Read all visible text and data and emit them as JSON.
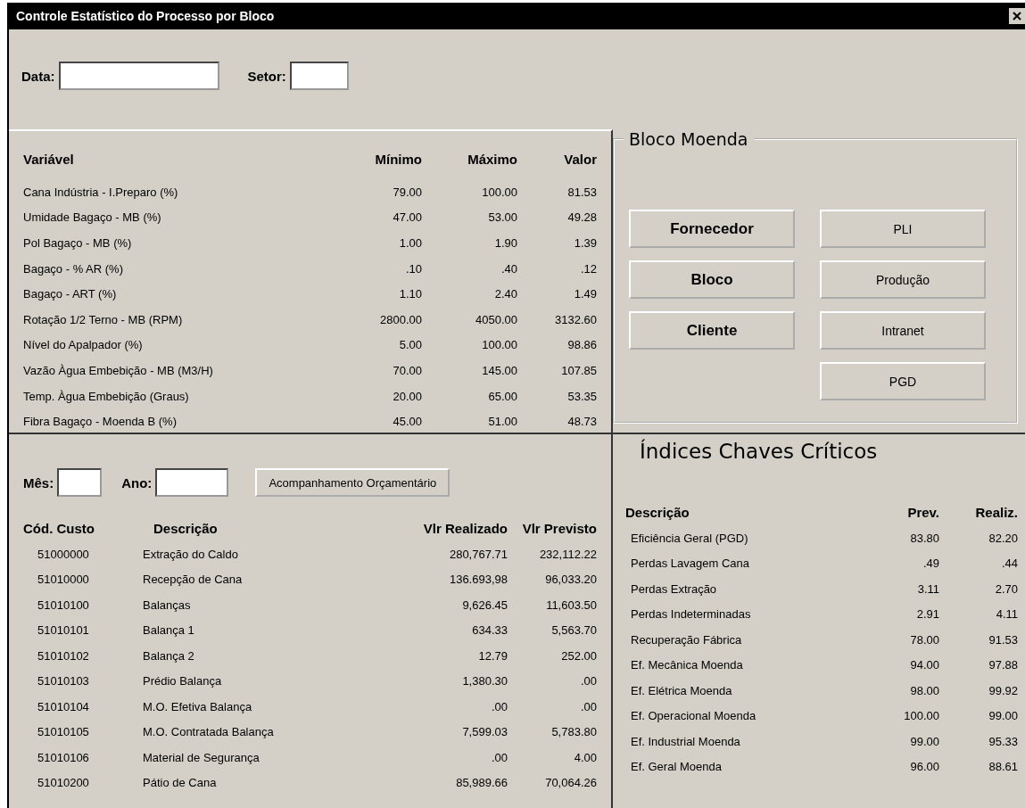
{
  "window": {
    "title": "Controle Estatístico do Processo por Bloco"
  },
  "filters": {
    "data_label": "Data:",
    "setor_label": "Setor:"
  },
  "variables": {
    "columns": [
      "Variável",
      "Mínimo",
      "Máximo",
      "Valor"
    ],
    "rows": [
      [
        "Cana Indústria - I.Preparo (%)",
        "79.00",
        "100.00",
        "81.53"
      ],
      [
        "Umidade Bagaço - MB (%)",
        "47.00",
        "53.00",
        "49.28"
      ],
      [
        "Pol Bagaço - MB (%)",
        "1.00",
        "1.90",
        "1.39"
      ],
      [
        "Bagaço - % AR (%)",
        ".10",
        ".40",
        ".12"
      ],
      [
        "Bagaço - ART (%)",
        "1.10",
        "2.40",
        "1.49"
      ],
      [
        "Rotação 1/2 Terno - MB (RPM)",
        "2800.00",
        "4050.00",
        "3132.60"
      ],
      [
        "Nível do Apalpador (%)",
        "5.00",
        "100.00",
        "98.86"
      ],
      [
        "Vazão Àgua Embebição - MB (M3/H)",
        "70.00",
        "145.00",
        "107.85"
      ],
      [
        "Temp. Àgua Embebição (Graus)",
        "20.00",
        "65.00",
        "53.35"
      ],
      [
        "Fibra Bagaço - Moenda B (%)",
        "45.00",
        "51.00",
        "48.73"
      ]
    ]
  },
  "bloco": {
    "title": "Bloco Moenda",
    "left_buttons": [
      {
        "label": "Fornecedor",
        "kind": "bold"
      },
      {
        "label": "Bloco",
        "kind": "bold"
      },
      {
        "label": "Cliente",
        "kind": "bold"
      }
    ],
    "right_buttons": [
      {
        "label": "PLI",
        "kind": "normal"
      },
      {
        "label": "Produção",
        "kind": "normal"
      },
      {
        "label": "Intranet",
        "kind": "normal"
      },
      {
        "label": "PGD",
        "kind": "normal"
      }
    ]
  },
  "budget": {
    "mes_label": "Mês:",
    "ano_label": "Ano:",
    "button": "Acompanhamento Orçamentário",
    "columns": [
      "Cód. Custo",
      "Descrição",
      "Vlr Realizado",
      "Vlr Previsto"
    ],
    "rows": [
      [
        "51000000",
        "Extração do Caldo",
        "280,767.71",
        "232,112.22"
      ],
      [
        "51010000",
        "Recepção de Cana",
        "136.693,98",
        "96,033.20"
      ],
      [
        "51010100",
        "Balanças",
        "9,626.45",
        "11,603.50"
      ],
      [
        "51010101",
        "Balança 1",
        "634.33",
        "5,563.70"
      ],
      [
        "51010102",
        "Balança 2",
        "12.79",
        "252.00"
      ],
      [
        "51010103",
        "Prédio Balança",
        "1,380.30",
        ".00"
      ],
      [
        "51010104",
        "M.O. Efetiva Balança",
        ".00",
        ".00"
      ],
      [
        "51010105",
        "M.O. Contratada Balança",
        "7,599.03",
        "5,783.80"
      ],
      [
        "51010106",
        "Material de Segurança",
        ".00",
        "4.00"
      ],
      [
        "51010200",
        "Pátio de Cana",
        "85,989.66",
        "70,064.26"
      ]
    ]
  },
  "indices": {
    "title": "Índices Chaves Críticos",
    "columns": [
      "Descrição",
      "Prev.",
      "Realiz."
    ],
    "rows": [
      [
        "Eficiência Geral (PGD)",
        "83.80",
        "82.20"
      ],
      [
        "Perdas Lavagem Cana",
        ".49",
        ".44"
      ],
      [
        "Perdas Extração",
        "3.11",
        "2.70"
      ],
      [
        "Perdas Indeterminadas",
        "2.91",
        "4.11"
      ],
      [
        "Recuperação Fábrica",
        "78.00",
        "91.53"
      ],
      [
        "Ef. Mecânica Moenda",
        "94.00",
        "97.88"
      ],
      [
        "Ef. Elétrica Moenda",
        "98.00",
        "99.92"
      ],
      [
        "Ef. Operacional Moenda",
        "100.00",
        "99.00"
      ],
      [
        "Ef. Industrial Moenda",
        "99.00",
        "95.33"
      ],
      [
        "Ef. Geral Moenda",
        "96.00",
        "88.61"
      ]
    ]
  }
}
